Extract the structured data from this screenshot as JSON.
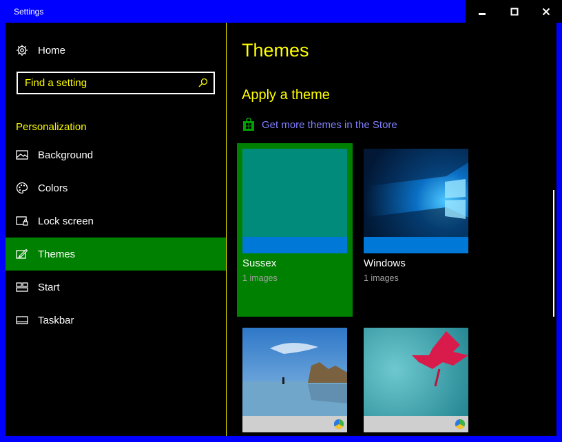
{
  "window": {
    "title": "Settings"
  },
  "sidebar": {
    "home_label": "Home",
    "search_placeholder": "Find a setting",
    "section_label": "Personalization",
    "items": [
      {
        "label": "Background",
        "icon": "picture-icon",
        "selected": false
      },
      {
        "label": "Colors",
        "icon": "palette-icon",
        "selected": false
      },
      {
        "label": "Lock screen",
        "icon": "lock-screen-icon",
        "selected": false
      },
      {
        "label": "Themes",
        "icon": "brush-icon",
        "selected": true
      },
      {
        "label": "Start",
        "icon": "start-icon",
        "selected": false
      },
      {
        "label": "Taskbar",
        "icon": "taskbar-icon",
        "selected": false
      }
    ]
  },
  "main": {
    "title": "Themes",
    "subtitle": "Apply a theme",
    "store_link": "Get more themes in the Store",
    "themes": [
      {
        "name": "Sussex",
        "count": "1 images",
        "selected": true,
        "color": "#008b7a"
      },
      {
        "name": "Windows",
        "count": "1 images",
        "selected": false
      },
      {
        "name": "",
        "count": "",
        "selected": false
      },
      {
        "name": "",
        "count": "",
        "selected": false
      }
    ]
  },
  "colors": {
    "titlebar": "#0000ff",
    "text_highlight": "#ffff00",
    "selection": "#008000",
    "link": "#8080ff",
    "accent": "#0078d7"
  }
}
